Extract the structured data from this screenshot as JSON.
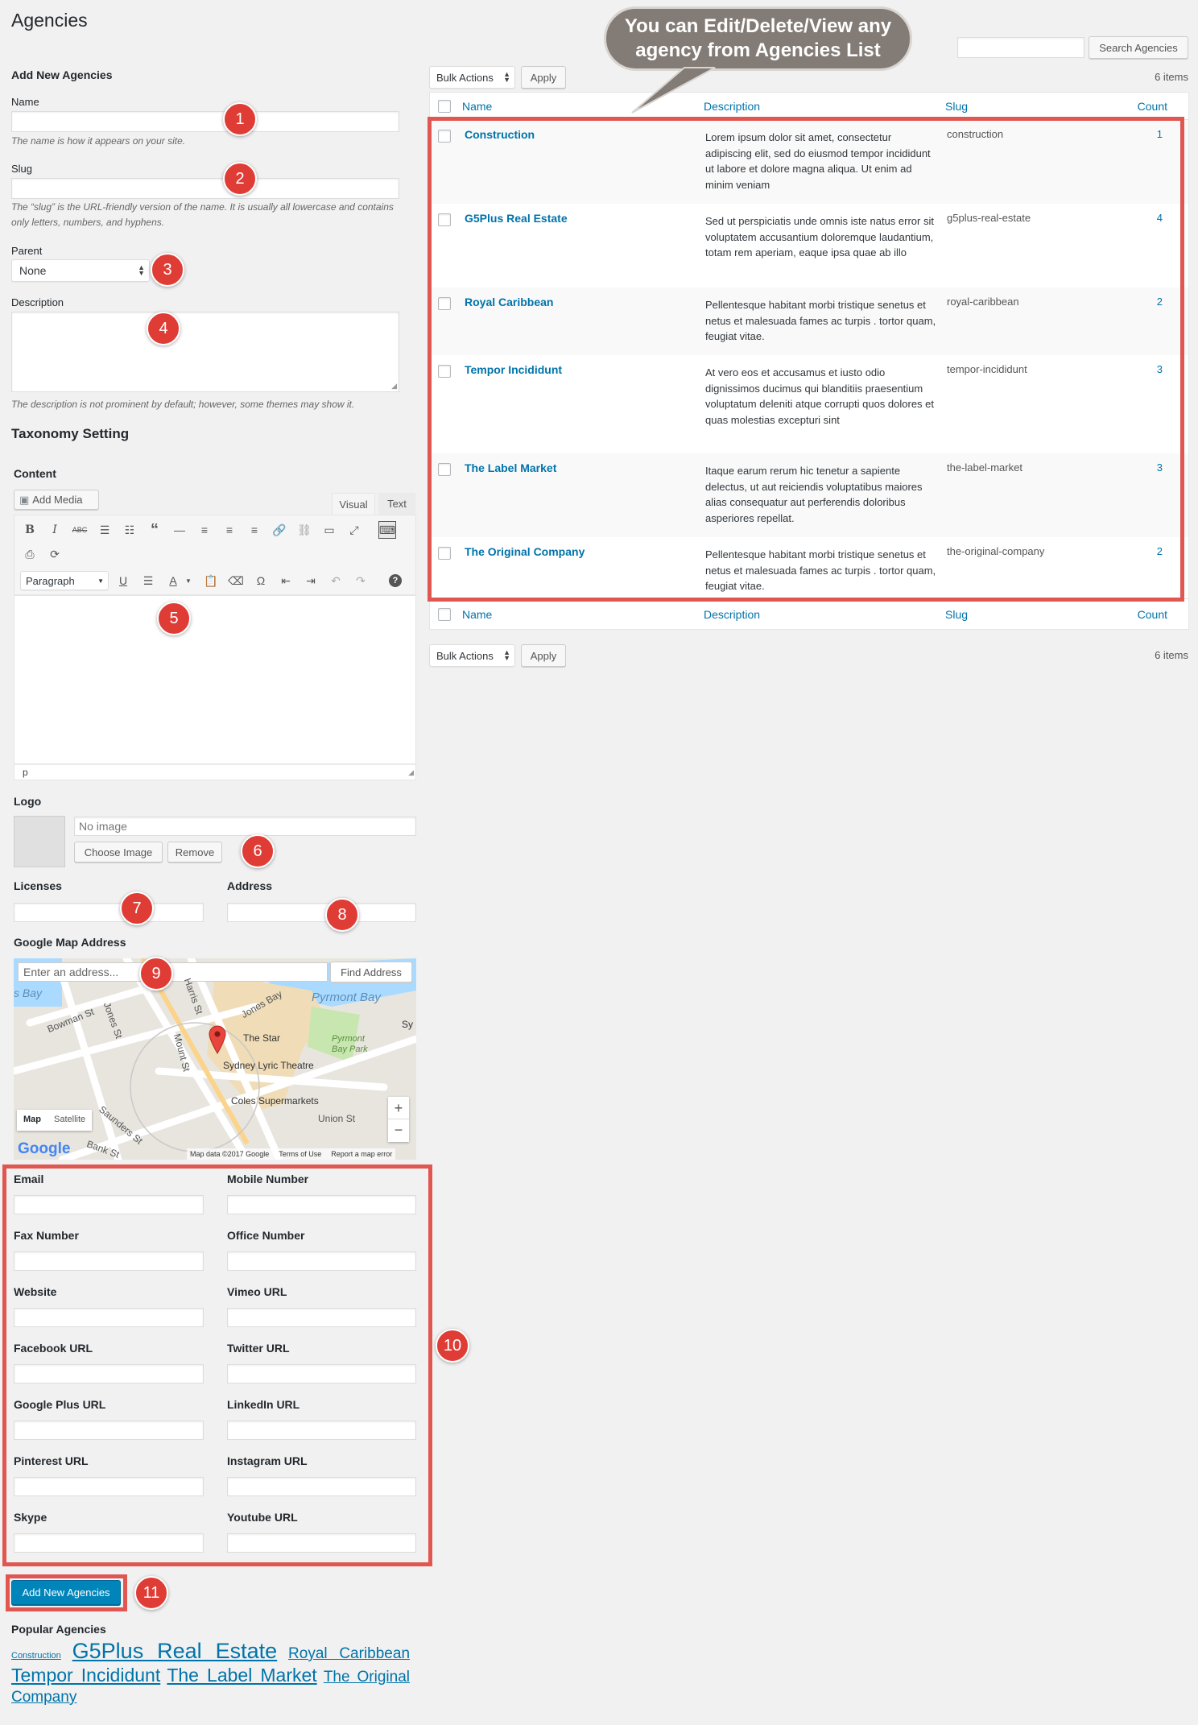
{
  "page": {
    "title": "Agencies"
  },
  "callout": "You can Edit/Delete/View any agency from Agencies List",
  "add_form": {
    "heading": "Add New Agencies",
    "name_label": "Name",
    "name_hint": "The name is how it appears on your site.",
    "slug_label": "Slug",
    "slug_hint": "The “slug” is the URL-friendly version of the name. It is usually all lowercase and contains only letters, numbers, and hyphens.",
    "parent_label": "Parent",
    "parent_value": "None",
    "description_label": "Description",
    "description_hint": "The description is not prominent by default; however, some themes may show it.",
    "taxonomy_heading": "Taxonomy Setting",
    "content_label": "Content",
    "add_media": "Add Media",
    "tab_visual": "Visual",
    "tab_text": "Text",
    "format_value": "Paragraph",
    "editor_path": "p",
    "logo_label": "Logo",
    "logo_placeholder": "No image",
    "choose_image": "Choose Image",
    "remove": "Remove",
    "licenses_label": "Licenses",
    "address_label": "Address",
    "map_label": "Google Map Address",
    "map_placeholder": "Enter an address...",
    "find_address": "Find Address",
    "submit": "Add New Agencies",
    "popular_heading": "Popular Agencies"
  },
  "map": {
    "type_map": "Map",
    "type_satellite": "Satellite",
    "brand": "Google",
    "footer": "Map data ©2017 Google",
    "terms": "Terms of Use",
    "report": "Report a map error",
    "places": {
      "pyrmont_bay": "Pyrmont Bay",
      "the_star": "The Star",
      "lyric": "Sydney Lyric Theatre",
      "coles": "Coles Supermarkets",
      "pyrmont_park": "Pyrmont Bay Park",
      "union": "Union St",
      "bowman": "Bowman St",
      "jones": "Jones St",
      "harris": "Harris St",
      "mount": "Mount St",
      "saunders": "Saunders St",
      "bank": "Bank St",
      "jones_bay": "Jones Bay",
      "bay": "s Bay",
      "sy": "Sy"
    }
  },
  "contact_fields": [
    [
      "Email",
      "Mobile Number"
    ],
    [
      "Fax Number",
      "Office Number"
    ],
    [
      "Website",
      "Vimeo URL"
    ],
    [
      "Facebook URL",
      "Twitter URL"
    ],
    [
      "Google Plus URL",
      "LinkedIn URL"
    ],
    [
      "Pinterest URL",
      "Instagram URL"
    ],
    [
      "Skype",
      "Youtube URL"
    ]
  ],
  "badges": [
    "1",
    "2",
    "3",
    "4",
    "5",
    "6",
    "7",
    "8",
    "9",
    "10",
    "11"
  ],
  "popular_tags": [
    "Construction",
    "G5Plus Real Estate",
    "Royal Caribbean",
    "Tempor Incididunt",
    "The Label Market",
    "The",
    "Original Company"
  ],
  "list": {
    "search_button": "Search Agencies",
    "bulk_actions": "Bulk Actions",
    "apply": "Apply",
    "items_count": "6 items",
    "columns": {
      "name": "Name",
      "description": "Description",
      "slug": "Slug",
      "count": "Count"
    },
    "rows": [
      {
        "name": "Construction",
        "description": "Lorem ipsum dolor sit amet, consectetur adipiscing elit, sed do eiusmod tempor incididunt ut labore et dolore magna aliqua. Ut enim ad minim veniam",
        "slug": "construction",
        "count": "1"
      },
      {
        "name": "G5Plus Real Estate",
        "description": "Sed ut perspiciatis unde omnis iste natus error sit voluptatem accusantium doloremque laudantium, totam rem aperiam, eaque ipsa quae ab illo",
        "slug": "g5plus-real-estate",
        "count": "4"
      },
      {
        "name": "Royal Caribbean",
        "description": "Pellentesque habitant morbi tristique senetus et netus et malesuada fames ac turpis . tortor quam, feugiat vitae.",
        "slug": "royal-caribbean",
        "count": "2"
      },
      {
        "name": "Tempor Incididunt",
        "description": "At vero eos et accusamus et iusto odio dignissimos ducimus qui blanditiis praesentium voluptatum deleniti atque corrupti quos dolores et quas molestias excepturi sint",
        "slug": "tempor-incididunt",
        "count": "3"
      },
      {
        "name": "The Label Market",
        "description": "Itaque earum rerum hic tenetur a sapiente delectus, ut aut reiciendis voluptatibus maiores alias consequatur aut perferendis doloribus asperiores repellat.",
        "slug": "the-label-market",
        "count": "3"
      },
      {
        "name": "The Original Company",
        "description": "Pellentesque habitant morbi tristique senetus et netus et malesuada fames ac turpis . tortor quam, feugiat vitae.",
        "slug": "the-original-company",
        "count": "2"
      }
    ]
  }
}
